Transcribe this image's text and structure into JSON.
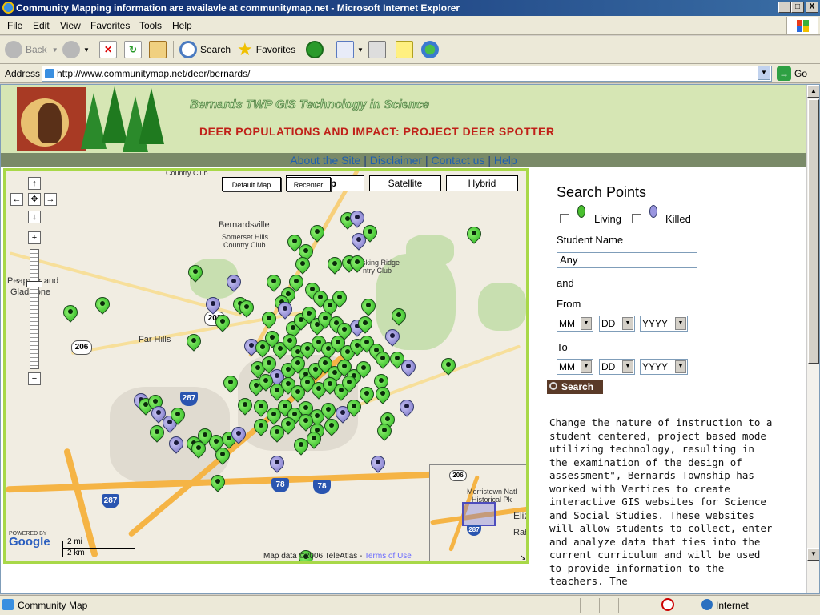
{
  "window": {
    "title": "Community Mapping information are availavle at communitymap.net - Microsoft Internet Explorer",
    "min": "_",
    "max": "□",
    "close": "X"
  },
  "menu": [
    "File",
    "Edit",
    "View",
    "Favorites",
    "Tools",
    "Help"
  ],
  "toolbar": {
    "back": "Back",
    "search": "Search",
    "favorites": "Favorites"
  },
  "address": {
    "label": "Address",
    "url": "http://www.communitymap.net/deer/bernards/",
    "go": "Go"
  },
  "banner": {
    "title1": "Bernards TWP GIS Technology in Science",
    "title2": "DEER POPULATIONS AND IMPACT: PROJECT DEER SPOTTER"
  },
  "nav": [
    "About the Site",
    "Disclaimer",
    "Contact us",
    "Help"
  ],
  "map": {
    "buttons": {
      "default_map": "Default Map",
      "recenter": "Recenter",
      "map": "p",
      "satellite": "Satellite",
      "hybrid": "Hybrid"
    },
    "labels": {
      "country_club": "Country Club",
      "bernardsville": "Bernardsville",
      "somerset": "Somerset Hills",
      "somerset2": "Country Club",
      "peapack": "Peapack and",
      "gladstone": "Gladstone",
      "far_hills": "Far Hills",
      "basking": "asking Ridge",
      "basking2": "ntry Club",
      "morristown": "Morristown Natl",
      "historical": "Historical Pk",
      "eliz": "Eliz",
      "rah": "Rah"
    },
    "shields": [
      "202",
      "206",
      "287",
      "78",
      "78",
      "287",
      "206",
      "287"
    ],
    "scale": {
      "mi": "2 mi",
      "km": "2 km"
    },
    "powered": "POWERED BY",
    "google": "Google",
    "mapdata": "Map data ©2006 TeleAtlas - ",
    "terms": "Terms of Use"
  },
  "panel": {
    "title": "Search Points",
    "living": "Living",
    "killed": "Killed",
    "student_label": "Student Name",
    "student_value": "Any",
    "and": "and",
    "from": "From",
    "to": "To",
    "mm": "MM",
    "dd": "DD",
    "yyyy": "YYYY",
    "search": "Search",
    "description": "Change the nature of instruction to a student centered, project based mode utilizing technology, resulting in the examination of the design of assessment\", Bernards Township has worked with Vertices to create interactive GIS websites for Science and Social Studies. These websites will allow students to collect, enter and analyze data that ties into the current curriculum and will be used to provide information to the teachers. The"
  },
  "status": {
    "text": "Community Map",
    "zone": "Internet"
  }
}
